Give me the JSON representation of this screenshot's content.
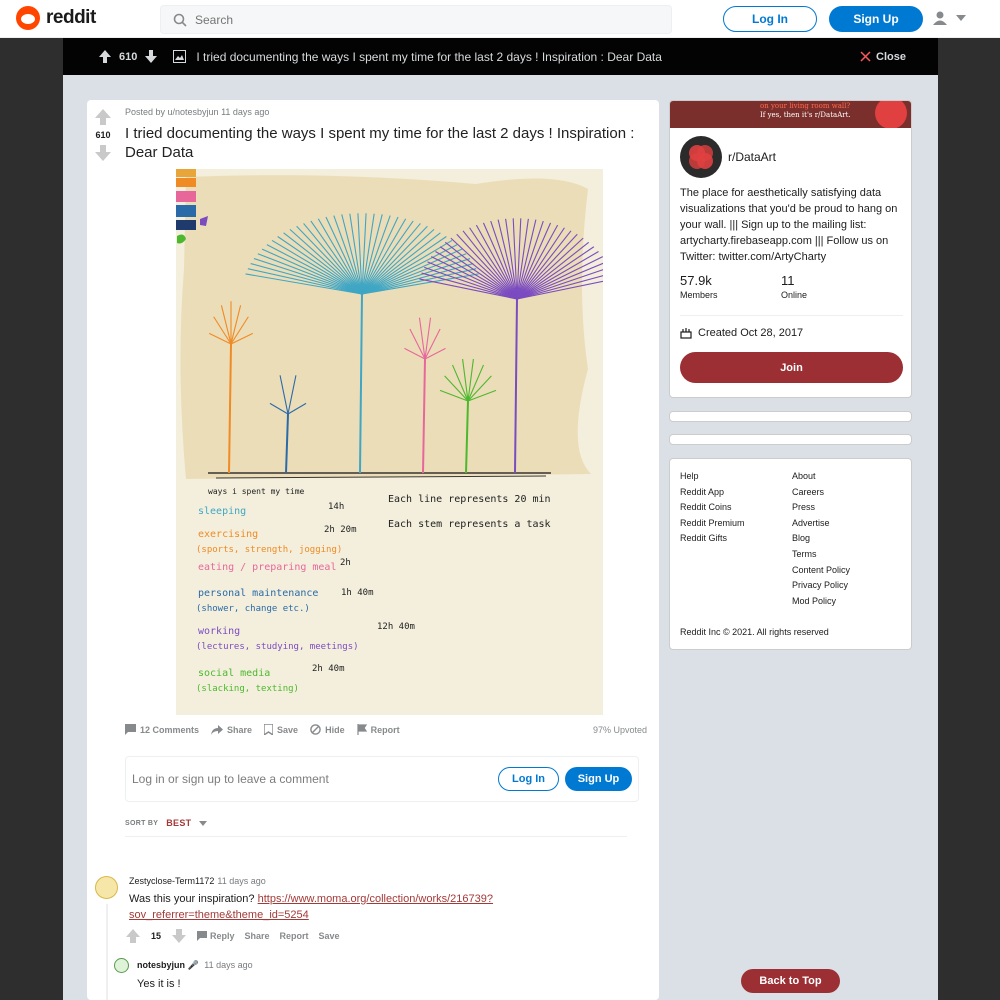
{
  "header": {
    "logo_text": "reddit",
    "search_placeholder": "Search",
    "login_label": "Log In",
    "signup_label": "Sign Up"
  },
  "postbar": {
    "score": "610",
    "title": "I tried documenting the ways I spent my time for the last 2 days ! Inspiration : Dear Data",
    "close_label": "Close"
  },
  "post": {
    "score": "610",
    "posted_by": "Posted by u/notesbyjun 11 days ago",
    "title": "I tried documenting the ways I spent my time for the last 2 days ! Inspiration : Dear Data",
    "artwork": {
      "legend_title": "ways i spent my time",
      "key_line": "Each line represents 20 min",
      "key_stem": "Each stem represents a task",
      "rows": [
        {
          "label": "sleeping",
          "sub": "",
          "value": "14h",
          "color": "#3fa6c4"
        },
        {
          "label": "exercising",
          "sub": "(sports, strength, jogging)",
          "value": "2h 20m",
          "color": "#f08a24"
        },
        {
          "label": "eating / preparing meal",
          "sub": "",
          "value": "2h",
          "color": "#e8679b"
        },
        {
          "label": "personal maintenance",
          "sub": "(shower, change etc.)",
          "value": "1h 40m",
          "color": "#2a6aa8"
        },
        {
          "label": "working",
          "sub": "(lectures, studying, meetings)",
          "value": "12h 40m",
          "color": "#7b4bc0"
        },
        {
          "label": "social media",
          "sub": "(slacking, texting)",
          "value": "2h 40m",
          "color": "#4cb82e"
        }
      ]
    },
    "actions": {
      "comments": "12 Comments",
      "share": "Share",
      "save": "Save",
      "hide": "Hide",
      "report": "Report",
      "upvoted": "97% Upvoted"
    },
    "comment_prompt": "Log in or sign up to leave a comment",
    "comment_login": "Log In",
    "comment_signup": "Sign Up",
    "sort_label": "SORT BY",
    "sort_value": "BEST"
  },
  "comments": [
    {
      "author": "Zestyclose-Term1172",
      "time": "11 days ago",
      "text": "Was this your inspiration?",
      "link": "https://www.moma.org/collection/works/216739?sov_referrer=theme&theme_id=5254",
      "score": "15",
      "actions": [
        "Reply",
        "Share",
        "Report",
        "Save"
      ]
    },
    {
      "author": "notesbyjun",
      "time": "11 days ago",
      "text": "Yes it is !"
    }
  ],
  "sidebar": {
    "banner_line1": "on your living room wall?",
    "banner_line2": "If yes, then it's r/DataArt.",
    "name": "r/DataArt",
    "description": "The place for aesthetically satisfying data visualizations that you'd be proud to hang on your wall. ||| Sign up to the mailing list: artycharty.firebaseapp.com ||| Follow us on Twitter: twitter.com/ArtyCharty",
    "members": "57.9k",
    "members_label": "Members",
    "online": "11",
    "online_label": "Online",
    "created": "Created Oct 28, 2017",
    "join_label": "Join",
    "links_left": [
      "Help",
      "Reddit App",
      "Reddit Coins",
      "Reddit Premium",
      "Reddit Gifts"
    ],
    "links_right": [
      "About",
      "Careers",
      "Press",
      "Advertise",
      "Blog",
      "Terms",
      "Content Policy",
      "Privacy Policy",
      "Mod Policy"
    ],
    "copyright": "Reddit Inc © 2021. All rights reserved"
  },
  "back_to_top": "Back to Top",
  "colors": {
    "accent": "#0079d3",
    "brand": "#ff4500",
    "community": "#9b2f33"
  }
}
